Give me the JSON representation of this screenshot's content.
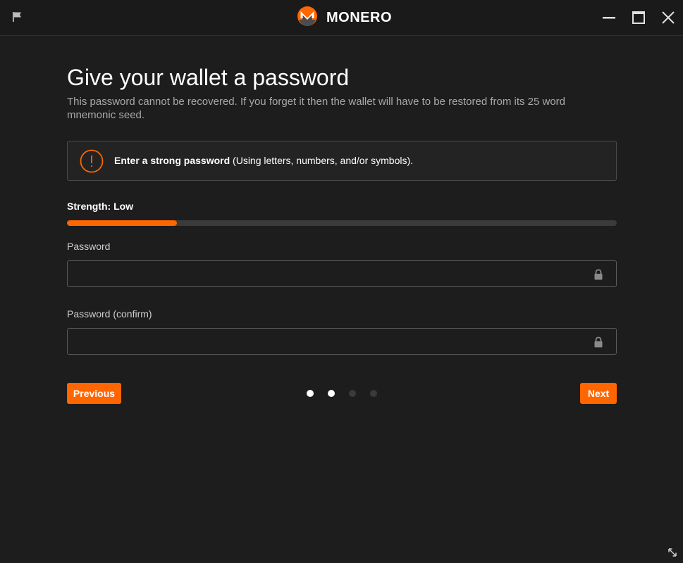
{
  "window": {
    "brand_name": "MONERO"
  },
  "page": {
    "title": "Give your wallet a password",
    "subtitle": "This password cannot be recovered. If you forget it then the wallet will have to be restored from its 25 word mnemonic seed."
  },
  "notice": {
    "icon": "warning-circle-icon",
    "strong_text": "Enter a strong password",
    "rest_text": " (Using letters, numbers, and/or symbols)."
  },
  "strength": {
    "label": "Strength: Low",
    "level_fraction": 0.2
  },
  "fields": {
    "password": {
      "label": "Password",
      "value": "",
      "placeholder": ""
    },
    "confirm": {
      "label": "Password (confirm)",
      "value": "",
      "placeholder": ""
    }
  },
  "navigation": {
    "previous_label": "Previous",
    "next_label": "Next",
    "steps": [
      {
        "state": "done"
      },
      {
        "state": "current"
      },
      {
        "state": "upcoming"
      },
      {
        "state": "upcoming"
      }
    ]
  },
  "colors": {
    "accent": "#ff6600",
    "background": "#1d1d1d",
    "dot_active": "#ffffff",
    "dot_inactive": "#3a3a3a"
  }
}
